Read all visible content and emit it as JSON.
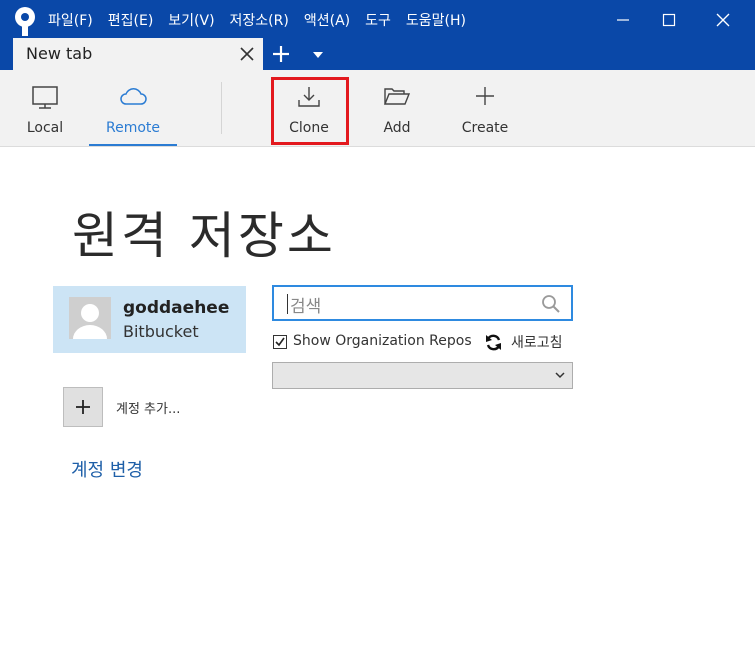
{
  "menu": [
    "파일(F)",
    "편집(E)",
    "보기(V)",
    "저장소(R)",
    "액션(A)",
    "도구",
    "도움말(H)"
  ],
  "tab": {
    "title": "New tab"
  },
  "toolbar": {
    "local": "Local",
    "remote": "Remote",
    "clone": "Clone",
    "add": "Add",
    "create": "Create"
  },
  "page": {
    "heading": "원격 저장소"
  },
  "account": {
    "username": "goddaehee",
    "service": "Bitbucket"
  },
  "add_account_label": "계정 추가...",
  "change_account_label": "계정 변경",
  "search": {
    "placeholder": "검색"
  },
  "show_org_repos": {
    "label": "Show Organization Repos",
    "checked": true
  },
  "refresh_label": "새로고침",
  "repo_select": {
    "value": ""
  },
  "colors": {
    "titlebar": "#0a48a8",
    "accent": "#2b7cd3",
    "highlight": "#e3191e",
    "selected_account": "#cce4f5"
  }
}
